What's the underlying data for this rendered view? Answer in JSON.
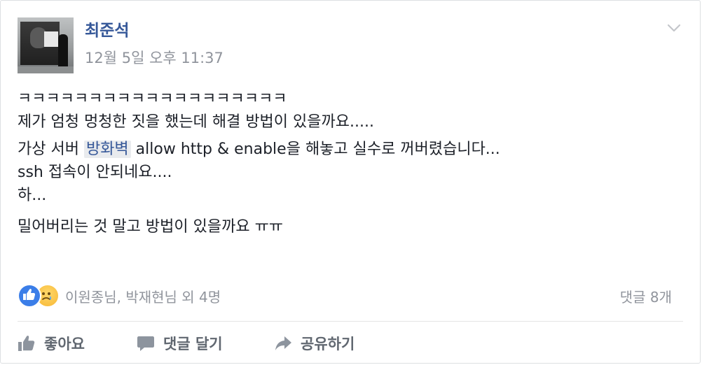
{
  "post": {
    "author": "최준석",
    "timestamp": "12월 5일 오후 11:37",
    "body": {
      "line1": "ㅋㅋㅋㅋㅋㅋㅋㅋㅋㅋㅋㅋㅋㅋㅋㅋㅋㅋㅋ",
      "line2": "제가 엄청 멍청한 짓을 했는데 해결 방법이 있을까요.....",
      "line3_prefix": "가상 서버 ",
      "line3_hashtag": "방화벽",
      "line3_suffix": " allow http & enable을 해놓고 실수로 꺼버렸습니다...",
      "line4": "ssh 접속이 안되네요....",
      "line5": "하...",
      "line6": "밀어버리는 것 말고 방법이 있을까요 ㅠㅠ"
    }
  },
  "reactions": {
    "icons": [
      "like-icon",
      "sad-icon"
    ],
    "names": "이원종님, 박재현님 외 4명",
    "comment_count": "댓글 8개"
  },
  "actions": {
    "like_label": "좋아요",
    "comment_label": "댓글 달기",
    "share_label": "공유하기"
  },
  "colors": {
    "author": "#365899",
    "meta": "#90949c",
    "action": "#606770",
    "like": "#3b7ee8"
  }
}
